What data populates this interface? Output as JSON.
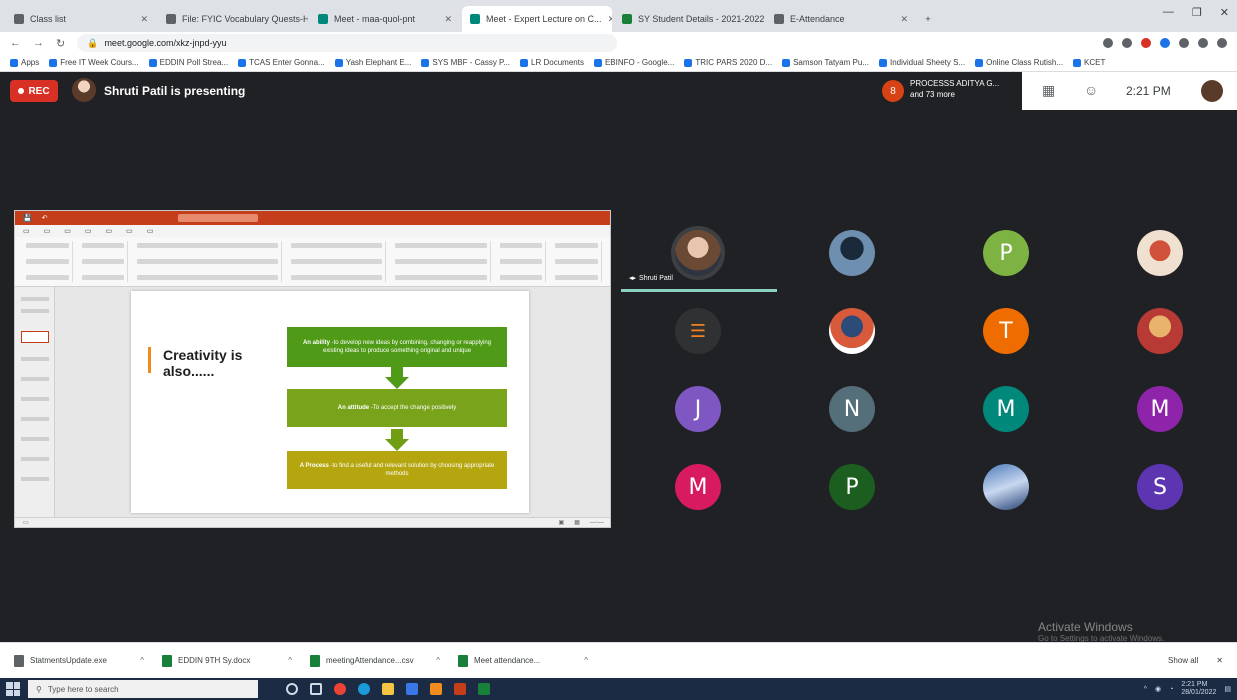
{
  "browser": {
    "tabs": [
      {
        "label": "Class list",
        "icon": "page-icon",
        "active": false
      },
      {
        "label": "File: FYIC Vocabulary Quests-HR...",
        "icon": "file-icon",
        "active": false
      },
      {
        "label": "Meet - maa-quol-pnt",
        "icon": "meet-icon",
        "active": false
      },
      {
        "label": "Meet - Expert Lecture on C...",
        "icon": "meet-icon",
        "active": true
      },
      {
        "label": "SY Student Details - 2021-2022",
        "icon": "sheet-icon",
        "active": false
      },
      {
        "label": "E-Attendance",
        "icon": "page-icon",
        "active": false
      }
    ],
    "url": "meet.google.com/xkz-jnpd-yyu",
    "bookmarks": [
      "Apps",
      "Free IT Week Cours...",
      "EDDIN Poll Strea...",
      "TCAS Enter Gonna...",
      "Yash Elephant E...",
      "SYS MBF - Cassy P...",
      "LR Documents",
      "EBINFO - Google...",
      "TRIC PARS 2020 D...",
      "Samson Tatyam Pu...",
      "Individual Sheety S...",
      "Online Class Rutish...",
      "KCET"
    ]
  },
  "meet": {
    "rec_label": "REC",
    "presenting_text": "Shruti Patil is presenting",
    "participants_badge": "8",
    "participants_line1": "PROCESSS ADITYA G...",
    "participants_line2": "and 73 more",
    "time": "2:21 PM",
    "speaker_name": "Shruti Patil"
  },
  "slide": {
    "title": "Creativity is also......",
    "box1_head": "An ability",
    "box1_text": "-to develop new ideas by combining, changing or reapplying existing ideas to produce something original and unique",
    "box2_head": "An attitude",
    "box2_text": "-To accept the change positively",
    "box3_head": "A Process",
    "box3_text": "-to find a useful and relevant solution by choosing appropriate methods"
  },
  "participants": [
    {
      "initial": "",
      "style": "photo"
    },
    {
      "initial": "",
      "style": "photo2"
    },
    {
      "initial": "P",
      "color": "#7cb342"
    },
    {
      "initial": "",
      "style": "photo3"
    },
    {
      "initial": "",
      "style": "so"
    },
    {
      "initial": "",
      "style": "photo4"
    },
    {
      "initial": "T",
      "color": "#ef6c00"
    },
    {
      "initial": "",
      "style": "photo5"
    },
    {
      "initial": "J",
      "color": "#7e57c2"
    },
    {
      "initial": "N",
      "color": "#546e7a"
    },
    {
      "initial": "M",
      "color": "#00897b"
    },
    {
      "initial": "M",
      "color": "#8e24aa"
    },
    {
      "initial": "M",
      "color": "#d81b60"
    },
    {
      "initial": "P",
      "color": "#1b5e20"
    },
    {
      "initial": "",
      "style": "photo6"
    },
    {
      "initial": "S",
      "color": "#5e35b1"
    }
  ],
  "watermark": {
    "title": "Activate Windows",
    "subtitle": "Go to Settings to activate Windows."
  },
  "downloads": {
    "items": [
      "StatmentsUpdate.exe",
      "EDDIN 9TH Sy.docx",
      "meetingAttendance...csv",
      "Meet attendance..."
    ],
    "show_all": "Show all"
  },
  "taskbar": {
    "search_placeholder": "Type here to search",
    "clock_time": "2:21 PM",
    "clock_date": "28/01/2022"
  },
  "colors": {
    "accent_meet": "#8ad1c2",
    "rec_red": "#d93025",
    "ppt_orange": "#c43e1c"
  }
}
